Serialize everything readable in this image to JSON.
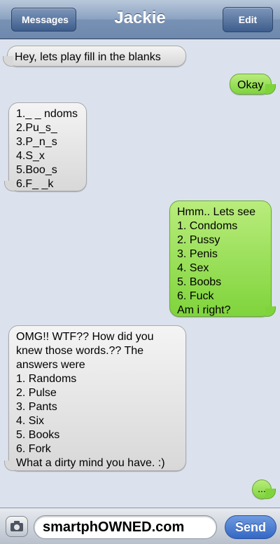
{
  "header": {
    "title": "Jackie",
    "back_label": "Messages",
    "edit_label": "Edit"
  },
  "messages": [
    {
      "text": "Hey, lets play fill in the blanks",
      "from": "them"
    },
    {
      "text": "Okay",
      "from": "me"
    },
    {
      "text": "1._ _ ndoms\n2.Pu_s_\n3.P_n_s\n4.S_x\n5.Boo_s\n6.F_ _k",
      "from": "them"
    },
    {
      "text": "Hmm.. Lets see\n1. Condoms\n2. Pussy\n3. Penis\n4. Sex\n5. Boobs\n6. Fuck\nAm i right?",
      "from": "me"
    },
    {
      "text": "OMG!! WTF?? How did you\nknew those words.?? The\nanswers were\n1. Randoms\n2. Pulse\n3. Pants\n4. Six\n5. Books\n6. Fork\nWhat a dirty mind you have. :)",
      "from": "them"
    },
    {
      "text": "...",
      "from": "me"
    }
  ],
  "compose": {
    "text": "smartphOWNED.com",
    "send_label": "Send"
  },
  "colors": {
    "sent_bubble": "#8fdc4c",
    "received_bubble": "#e2e2e2",
    "background": "#dbe2ed",
    "nav": "#7892b5",
    "send_button": "#3d6fc9"
  }
}
